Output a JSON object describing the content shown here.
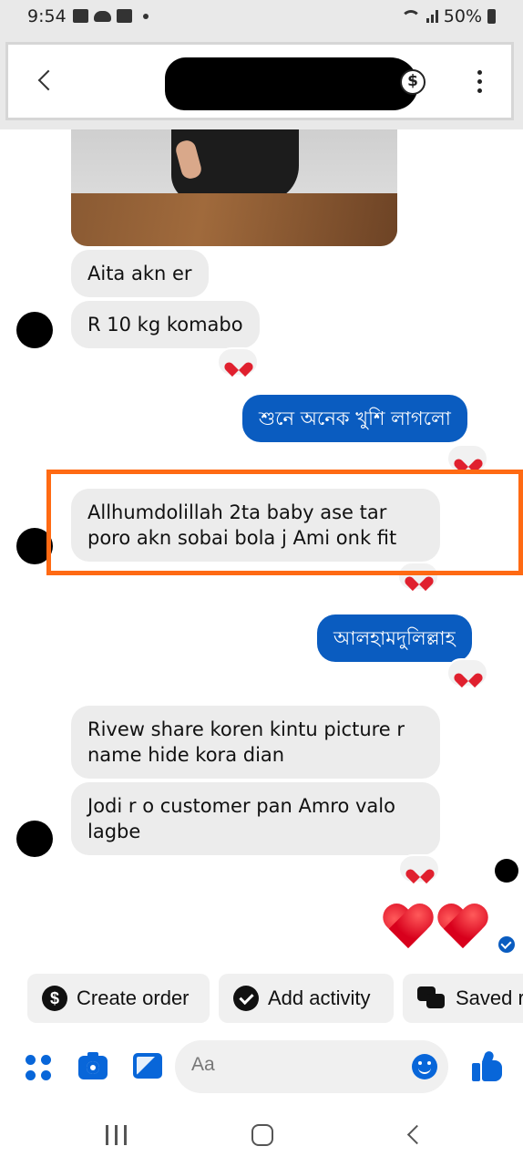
{
  "status_bar": {
    "time": "9:54",
    "battery": "50%"
  },
  "header": {
    "contact_name": ""
  },
  "messages": [
    {
      "id": "m1",
      "direction": "incoming",
      "text": "Aita akn er"
    },
    {
      "id": "m2",
      "direction": "incoming",
      "text": "R 10 kg komabo",
      "reaction": "heart"
    },
    {
      "id": "m3",
      "direction": "outgoing",
      "text": "শুনে অনেক খুশি লাগলো",
      "reaction": "heart"
    },
    {
      "id": "m4",
      "direction": "incoming",
      "text_line1": "Allhumdolillah 2ta baby ase tar",
      "text_line2": "poro akn  sobai bola j Ami onk fit",
      "reaction": "heart",
      "highlighted": true
    },
    {
      "id": "m5",
      "direction": "outgoing",
      "text": "আলহামদুলিল্লাহ",
      "reaction": "heart"
    },
    {
      "id": "m6",
      "direction": "incoming",
      "text_line1": "Rivew share koren kintu picture r",
      "text_line2": "name hide kora dian"
    },
    {
      "id": "m7",
      "direction": "incoming",
      "text_line1": "Jodi r o customer pan Amro valo",
      "text_line2": "lagbe",
      "reaction": "heart"
    },
    {
      "id": "m8",
      "direction": "outgoing",
      "content": "two-red-hearts"
    }
  ],
  "quick_actions": [
    {
      "label": "Create order",
      "icon": "dollar-icon"
    },
    {
      "label": "Add activity",
      "icon": "check-circle-icon"
    },
    {
      "label": "Saved r",
      "icon": "saved-replies-icon"
    }
  ],
  "composer": {
    "placeholder": "Aa"
  },
  "colors": {
    "accent": "#0866d9",
    "outgoing_bubble": "#0a5cc0",
    "incoming_bubble": "#ececec",
    "highlight": "#ff6a13",
    "heart": "#e0202e"
  }
}
